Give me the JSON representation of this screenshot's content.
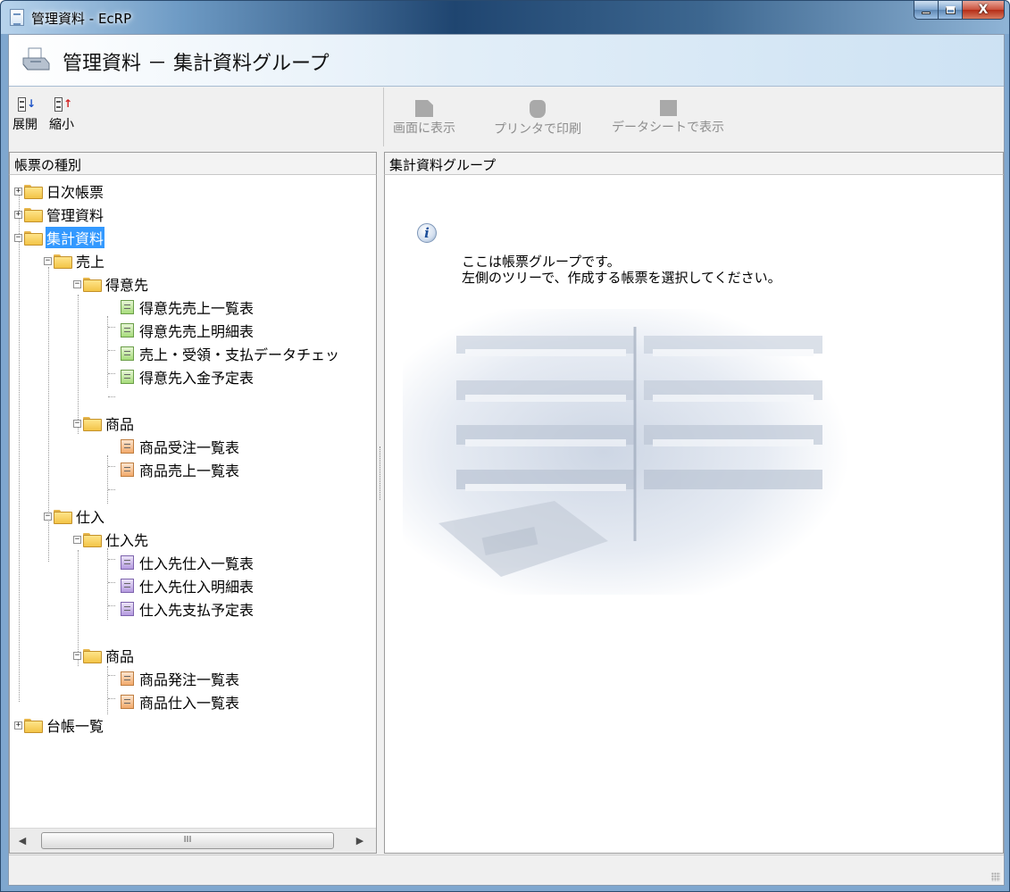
{
  "window": {
    "title": "管理資料 - EcRP"
  },
  "banner": {
    "title": "管理資料 － 集計資料グループ"
  },
  "left_toolbar": {
    "expand_label": "展開",
    "shrink_label": "縮小"
  },
  "right_toolbar": {
    "show_screen_label": "画面に表示",
    "print_label": "プリンタで印刷",
    "datasheet_label": "データシートで表示"
  },
  "left_pane": {
    "header": "帳票の種別"
  },
  "right_pane": {
    "header": "集計資料グループ",
    "info_line1": "ここは帳票グループです。",
    "info_line2": "左側のツリーで、作成する帳票を選択してください。"
  },
  "tree": {
    "n0": "日次帳票",
    "n1": "管理資料",
    "n2": "集計資料",
    "n3": "売上",
    "n4": "得意先",
    "n5": "得意先売上一覧表",
    "n6": "得意先売上明細表",
    "n7": "売上・受領・支払データチェッ",
    "n8": "得意先入金予定表",
    "n9": "商品",
    "n10": "商品受注一覧表",
    "n11": "商品売上一覧表",
    "n12": "仕入",
    "n13": "仕入先",
    "n14": "仕入先仕入一覧表",
    "n15": "仕入先仕入明細表",
    "n16": "仕入先支払予定表",
    "n17": "商品",
    "n18": "商品発注一覧表",
    "n19": "商品仕入一覧表",
    "n20": "台帳一覧"
  },
  "icons": {
    "report_green": "green-report-icon",
    "report_orange": "orange-report-icon",
    "report_purple": "purple-report-icon",
    "folder": "folder-icon"
  },
  "colors": {
    "selection": "#3399ff",
    "titlebar": "#1f4570"
  }
}
